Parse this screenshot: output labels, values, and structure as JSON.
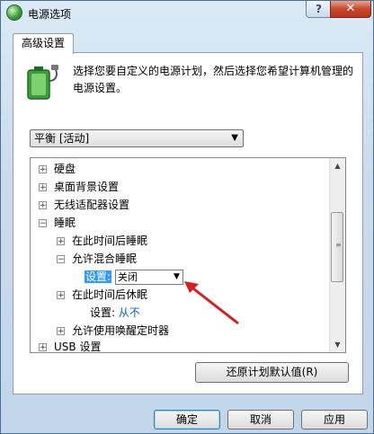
{
  "window": {
    "title": "电源选项",
    "help_glyph": "?",
    "close_glyph": "✕"
  },
  "tab": {
    "label": "高级设置"
  },
  "description": "选择您要自定义的电源计划，然后选择您希望计算机管理的电源设置。",
  "plan_select": {
    "value": "平衡 [活动]"
  },
  "tree": {
    "items": [
      {
        "label": "硬盘",
        "toggle": "+",
        "level": 0
      },
      {
        "label": "桌面背景设置",
        "toggle": "+",
        "level": 0
      },
      {
        "label": "无线适配器设置",
        "toggle": "+",
        "level": 0
      },
      {
        "label": "睡眠",
        "toggle": "−",
        "level": 0
      },
      {
        "label": "在此时间后睡眠",
        "toggle": "+",
        "level": 1
      },
      {
        "label": "允许混合睡眠",
        "toggle": "−",
        "level": 1
      },
      {
        "label": "在此时间后休眠",
        "toggle": "+",
        "level": 1
      },
      {
        "label": "允许使用唤醒定时器",
        "toggle": "+",
        "level": 1
      },
      {
        "label": "USB 设置",
        "toggle": "+",
        "level": 0
      }
    ],
    "hybrid_setting": {
      "label": "设置:",
      "value": "关闭"
    },
    "hibernate_setting": {
      "label": "设置:",
      "value": "从不"
    }
  },
  "restore_button": "还原计划默认值(R)",
  "footer": {
    "ok": "确定",
    "cancel": "取消",
    "apply": "应用"
  },
  "annotation_color": "#d42020"
}
